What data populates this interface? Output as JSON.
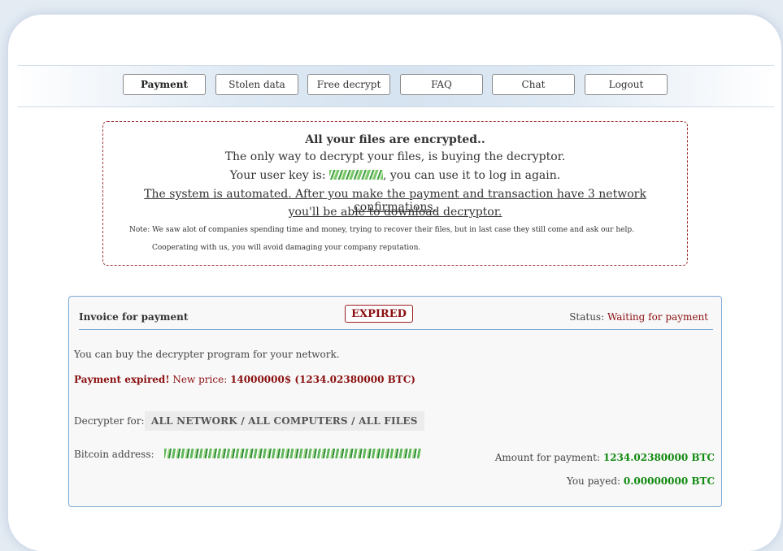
{
  "nav": {
    "items": [
      {
        "label": "Payment",
        "active": true
      },
      {
        "label": "Stolen data",
        "active": false
      },
      {
        "label": "Free decrypt",
        "active": false
      },
      {
        "label": "FAQ",
        "active": false
      },
      {
        "label": "Chat",
        "active": false
      },
      {
        "label": "Logout",
        "active": false
      }
    ]
  },
  "notice": {
    "title": "All your files are encrypted..",
    "line2": "The only way to decrypt your files, is buying the decryptor.",
    "key_prefix": "Your user key is:",
    "key_suffix": ", you can use it to log in again.",
    "line4": "The system is automated. After you make the payment and transaction have 3 network confirmations,",
    "line5": "you'll be able to download decryptor.",
    "note": "Note: We saw alot of companies spending time and money, trying to recover their files, but in last case they still come and ask our help.",
    "cooperating": "Cooperating with us, you will avoid damaging your company reputation."
  },
  "invoice": {
    "title": "Invoice for payment",
    "badge": "EXPIRED",
    "status_label": "Status:",
    "status_value": "Waiting for payment",
    "buy_text": "You can buy the decrypter program for your network.",
    "expired_bold": "Payment expired!",
    "new_price_label": "New price:",
    "new_price_value": "14000000$ (1234.02380000 BTC)",
    "decrypter_label": "Decrypter for:",
    "decrypter_value": "ALL NETWORK / ALL COMPUTERS / ALL FILES",
    "bitcoin_label": "Bitcoin address:",
    "amount_label": "Amount for payment:",
    "amount_value": "1234.02380000 BTC",
    "payed_label": "You payed:",
    "payed_value": "0.00000000 BTC"
  },
  "colors": {
    "accent_red": "#8a1010",
    "accent_green": "#118a11",
    "border_blue": "#7aa8d6"
  }
}
